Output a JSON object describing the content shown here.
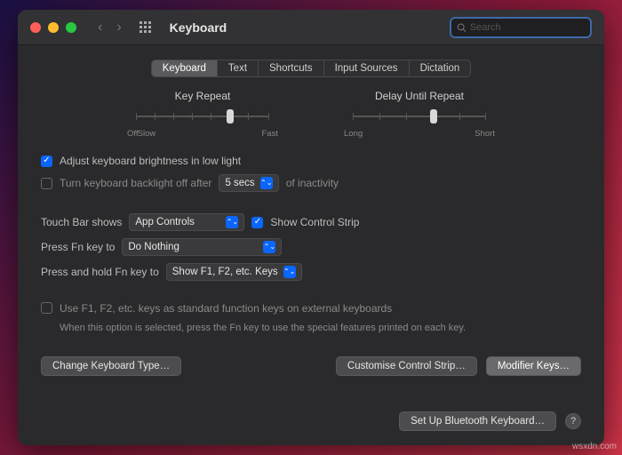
{
  "window": {
    "title": "Keyboard"
  },
  "search": {
    "placeholder": "Search"
  },
  "tabs": [
    "Keyboard",
    "Text",
    "Shortcuts",
    "Input Sources",
    "Dictation"
  ],
  "sliders": {
    "key_repeat": {
      "label": "Key Repeat",
      "left": "Off",
      "mid": "Slow",
      "right": "Fast"
    },
    "delay": {
      "label": "Delay Until Repeat",
      "left": "Long",
      "right": "Short"
    }
  },
  "checks": {
    "adjust_brightness": "Adjust keyboard brightness in low light",
    "backlight_off": "Turn keyboard backlight off after",
    "inactivity_suffix": "of inactivity",
    "backlight_value": "5 secs",
    "show_control_strip": "Show Control Strip",
    "fn_standard": "Use F1, F2, etc. keys as standard function keys on external keyboards",
    "fn_note": "When this option is selected, press the Fn key to use the special features printed on each key."
  },
  "selects": {
    "touchbar_label": "Touch Bar shows",
    "touchbar_value": "App Controls",
    "fn_label": "Press Fn key to",
    "fn_value": "Do Nothing",
    "hold_fn_label": "Press and hold Fn key to",
    "hold_fn_value": "Show F1, F2, etc. Keys"
  },
  "buttons": {
    "change_type": "Change Keyboard Type…",
    "customise": "Customise Control Strip…",
    "modifier": "Modifier Keys…",
    "bluetooth": "Set Up Bluetooth Keyboard…"
  },
  "watermark": "wsxdn.com"
}
